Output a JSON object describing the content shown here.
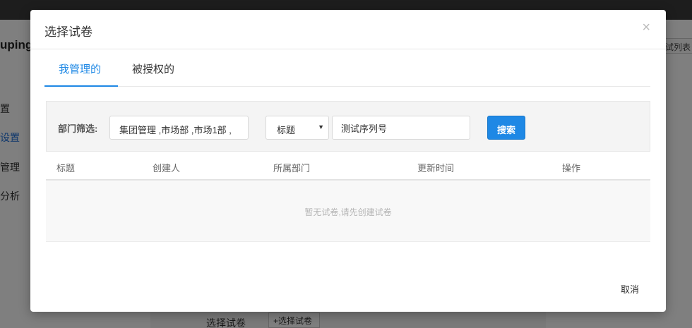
{
  "background": {
    "brand": "uping",
    "nav_items": [
      "置",
      "设置",
      "管理",
      "分析"
    ],
    "right_button": "试列表",
    "bottom_label": "选择试卷",
    "bottom_button": "+选择试卷"
  },
  "modal": {
    "title": "选择试卷",
    "close_label": "×",
    "tabs": [
      {
        "label": "我管理的",
        "active": true
      },
      {
        "label": "被授权的",
        "active": false
      }
    ],
    "filter": {
      "dept_label": "部门筛选:",
      "dept_value": "集团管理 ,市场部 ,市场1部 ,",
      "field_select": "标题",
      "search_value": "测试序列号",
      "search_button": "搜索"
    },
    "table": {
      "headers": [
        "标题",
        "创建人",
        "所属部门",
        "更新时间",
        "操作"
      ],
      "empty_text": "暂无试卷,请先创建试卷"
    },
    "cancel_label": "取消"
  },
  "colors": {
    "accent": "#1e88e5",
    "overlay": "rgba(0,0,0,0.5)"
  }
}
